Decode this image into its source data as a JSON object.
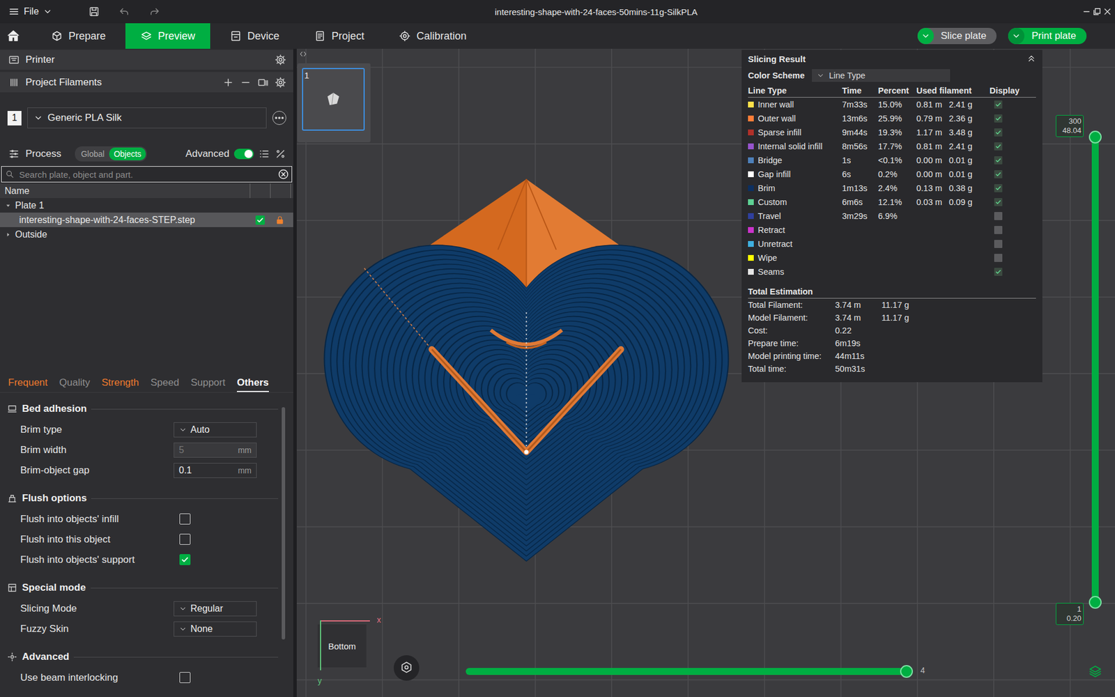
{
  "window": {
    "menu": "File",
    "title": "interesting-shape-with-24-faces-50mins-11g-SilkPLA"
  },
  "nav": {
    "tabs": [
      {
        "label": "Prepare",
        "selected": false
      },
      {
        "label": "Preview",
        "selected": true
      },
      {
        "label": "Device",
        "selected": false
      },
      {
        "label": "Project",
        "selected": false
      },
      {
        "label": "Calibration",
        "selected": false
      }
    ],
    "actions": [
      "Slice plate",
      "Print plate"
    ]
  },
  "sidebar": {
    "printer": "Printer",
    "filaments": {
      "title": "Project Filaments",
      "items": [
        {
          "index": "1",
          "name": "Generic PLA Silk"
        }
      ]
    },
    "process": {
      "title": "Process",
      "modes": [
        {
          "label": "Global",
          "selected": false
        },
        {
          "label": "Objects",
          "selected": true
        }
      ],
      "advanced": {
        "label": "Advanced",
        "on": true
      }
    },
    "search": {
      "placeholder": "Search plate, object and part."
    },
    "tree": {
      "column": "Name",
      "items": [
        {
          "kind": "plate",
          "label": "Plate 1",
          "expanded": true
        },
        {
          "kind": "object",
          "label": "interesting-shape-with-24-faces-STEP.step",
          "selected": true,
          "checked": true,
          "locked": true
        },
        {
          "kind": "group",
          "label": "Outside",
          "expanded": false
        }
      ]
    },
    "tabs": [
      {
        "label": "Frequent",
        "selected": false,
        "modified": true
      },
      {
        "label": "Quality",
        "selected": false,
        "modified": false
      },
      {
        "label": "Strength",
        "selected": false,
        "modified": true
      },
      {
        "label": "Speed",
        "selected": false,
        "modified": false
      },
      {
        "label": "Support",
        "selected": false,
        "modified": false
      },
      {
        "label": "Others",
        "selected": true,
        "modified": false
      }
    ],
    "sections": [
      {
        "title": "Bed adhesion",
        "settings": [
          {
            "kind": "dropdown",
            "label": "Brim type",
            "value": "Auto"
          },
          {
            "kind": "number",
            "label": "Brim width",
            "value": "5",
            "unit": "mm",
            "disabled": true
          },
          {
            "kind": "number",
            "label": "Brim-object gap",
            "value": "0.1",
            "unit": "mm",
            "disabled": false
          }
        ]
      },
      {
        "title": "Flush options",
        "settings": [
          {
            "kind": "checkbox",
            "label": "Flush into objects' infill",
            "checked": false
          },
          {
            "kind": "checkbox",
            "label": "Flush into this object",
            "checked": false
          },
          {
            "kind": "checkbox",
            "label": "Flush into objects' support",
            "checked": true
          }
        ]
      },
      {
        "title": "Special mode",
        "settings": [
          {
            "kind": "dropdown",
            "label": "Slicing Mode",
            "value": "Regular"
          },
          {
            "kind": "dropdown",
            "label": "Fuzzy Skin",
            "value": "None"
          }
        ]
      },
      {
        "title": "Advanced",
        "settings": [
          {
            "kind": "checkbox",
            "label": "Use beam interlocking",
            "checked": false
          }
        ]
      }
    ]
  },
  "viewport": {
    "plates": [
      {
        "label": "1",
        "selected": true
      }
    ],
    "view_label": "Bottom",
    "axes": [
      "x",
      "y"
    ],
    "layer_slider": {
      "level": 1,
      "top": [
        "300",
        "48.04"
      ],
      "bottom": [
        "1",
        "0.20"
      ]
    },
    "move_slider": {
      "level": 1,
      "reading": "4"
    }
  },
  "slicing_result": {
    "title": "Slicing Result",
    "color_scheme": {
      "label": "Color Scheme",
      "value": "Line Type"
    },
    "columns": [
      "Line Type",
      "Time",
      "Percent",
      "Used filament",
      "Display"
    ],
    "rows": [
      {
        "name": "Inner wall",
        "color": "#ffe04a",
        "time": "7m33s",
        "percent": "15.0%",
        "length": "0.81 m",
        "weight": "2.41 g",
        "display": true
      },
      {
        "name": "Outer wall",
        "color": "#ff7d38",
        "time": "13m6s",
        "percent": "25.9%",
        "length": "0.79 m",
        "weight": "2.36 g",
        "display": true
      },
      {
        "name": "Sparse infill",
        "color": "#b03029",
        "time": "9m44s",
        "percent": "19.3%",
        "length": "1.17 m",
        "weight": "3.48 g",
        "display": true
      },
      {
        "name": "Internal solid infill",
        "color": "#9654cc",
        "time": "8m56s",
        "percent": "17.7%",
        "length": "0.81 m",
        "weight": "2.41 g",
        "display": true
      },
      {
        "name": "Bridge",
        "color": "#4d80ba",
        "time": "1s",
        "percent": "<0.1%",
        "length": "0.00 m",
        "weight": "0.01 g",
        "display": true
      },
      {
        "name": "Gap infill",
        "color": "#ffffff",
        "time": "6s",
        "percent": "0.2%",
        "length": "0.00 m",
        "weight": "0.01 g",
        "display": true
      },
      {
        "name": "Brim",
        "color": "#0c2f60",
        "time": "1m13s",
        "percent": "2.4%",
        "length": "0.13 m",
        "weight": "0.38 g",
        "display": true
      },
      {
        "name": "Custom",
        "color": "#5ed194",
        "time": "6m6s",
        "percent": "12.1%",
        "length": "0.03 m",
        "weight": "0.09 g",
        "display": true
      },
      {
        "name": "Travel",
        "color": "#2f3f9e",
        "time": "3m29s",
        "percent": "6.9%",
        "display": false
      },
      {
        "name": "Retract",
        "color": "#cc33cc",
        "display": false
      },
      {
        "name": "Unretract",
        "color": "#3fb0e0",
        "display": false
      },
      {
        "name": "Wipe",
        "color": "#ffff00",
        "display": false
      },
      {
        "name": "Seams",
        "color": "#e6e6e6",
        "display": true
      }
    ],
    "total": {
      "title": "Total Estimation",
      "rows": [
        {
          "label": "Total Filament:",
          "values": [
            "3.74 m",
            "11.17 g"
          ]
        },
        {
          "label": "Model Filament:",
          "values": [
            "3.74 m",
            "11.17 g"
          ]
        },
        {
          "label": "Cost:",
          "values": [
            "0.22"
          ]
        },
        {
          "label": "Prepare time:",
          "values": [
            "6m19s"
          ]
        },
        {
          "label": "Model printing time:",
          "values": [
            "44m11s"
          ]
        },
        {
          "label": "Total time:",
          "values": [
            "50m31s"
          ]
        }
      ]
    }
  }
}
